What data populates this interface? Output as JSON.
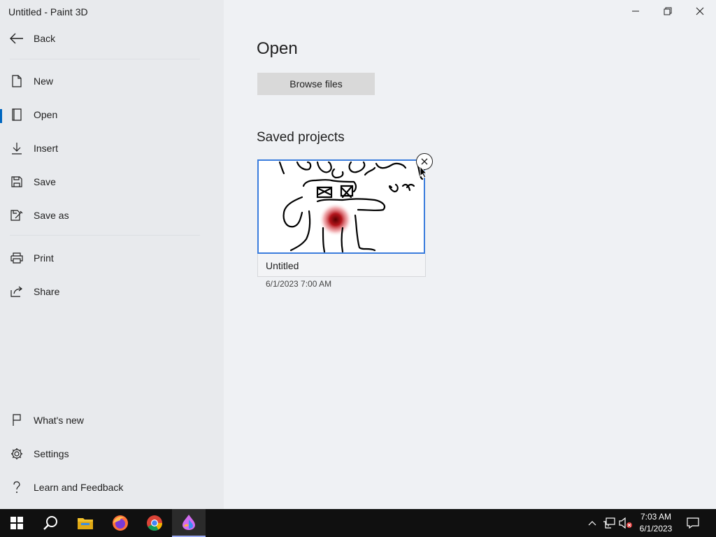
{
  "window": {
    "title": "Untitled - Paint 3D",
    "controls": [
      "minimize-icon",
      "restore-icon",
      "close-icon"
    ]
  },
  "sidebar": {
    "back_label": "Back",
    "items": [
      {
        "label": "New",
        "icon": "new-file-icon"
      },
      {
        "label": "Open",
        "icon": "open-icon",
        "active": true
      },
      {
        "label": "Insert",
        "icon": "insert-icon"
      },
      {
        "label": "Save",
        "icon": "save-icon"
      },
      {
        "label": "Save as",
        "icon": "save-as-icon"
      },
      {
        "label": "Print",
        "icon": "print-icon"
      },
      {
        "label": "Share",
        "icon": "share-icon"
      }
    ],
    "bottom_items": [
      {
        "label": "What's new",
        "icon": "flag-icon"
      },
      {
        "label": "Settings",
        "icon": "gear-icon"
      },
      {
        "label": "Learn and Feedback",
        "icon": "question-icon"
      }
    ]
  },
  "main": {
    "title": "Open",
    "browse_label": "Browse files",
    "saved_title": "Saved projects",
    "projects": [
      {
        "name": "Untitled",
        "date": "6/1/2023 7:00 AM"
      }
    ]
  },
  "taskbar": {
    "apps": [
      "windows-start-icon",
      "search-icon",
      "file-explorer-icon",
      "firefox-icon",
      "chrome-icon",
      "paint-3d-icon"
    ],
    "active_app": "paint-3d-icon",
    "tray": [
      "chevron-up-icon",
      "network-icon",
      "volume-muted-icon"
    ],
    "time": "7:03 AM",
    "date": "6/1/2023",
    "colors": {
      "background": "#101010",
      "accent": "#9aa9f2"
    }
  },
  "colors": {
    "accent": "#0067c0",
    "selection_border": "#3b7ddd",
    "button": "#d9d9d9"
  }
}
